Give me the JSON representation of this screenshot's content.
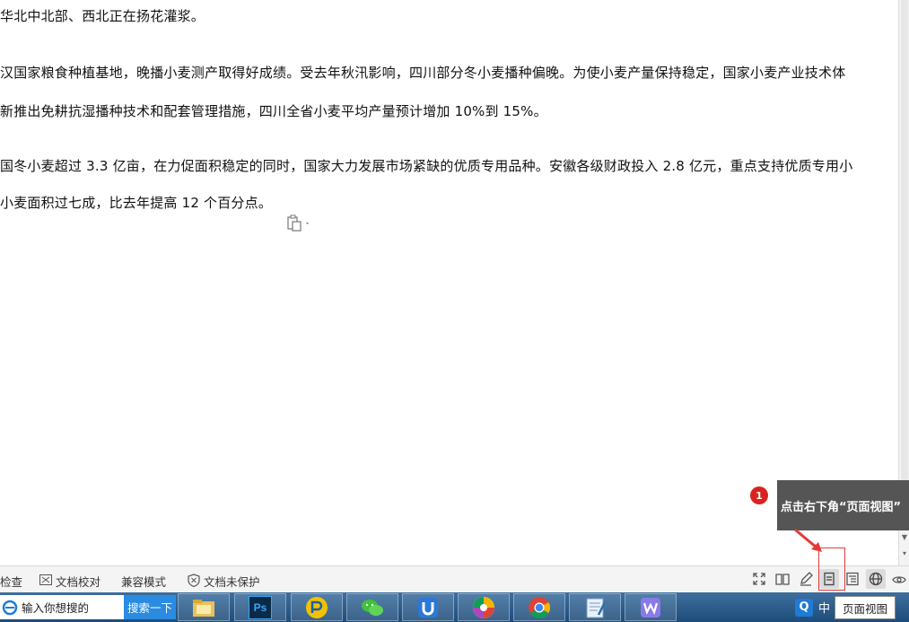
{
  "document": {
    "lines": [
      "华北中北部、西北正在扬花灌浆。",
      "汉国家粮食种植基地，晚播小麦测产取得好成绩。受去年秋汛影响，四川部分冬小麦播种偏晚。为使小麦产量保持稳定，国家小麦产业技术体",
      "新推出免耕抗湿播种技术和配套管理措施，四川全省小麦平均产量预计增加 10%到 15%。",
      "国冬小麦超过 3.3 亿亩，在力促面积稳定的同时，国家大力发展市场紧缺的优质专用品种。安徽各级财政投入 2.8 亿元，重点支持优质专用小",
      "小麦面积过七成，比去年提高 12 个百分点。"
    ]
  },
  "statusbar": {
    "check_label": "检查",
    "proofread_label": "文档校对",
    "compat_label": "兼容模式",
    "protect_label": "文档未保护",
    "view_icons": [
      "fullscreen-icon",
      "reading-view-icon",
      "edit-pen-icon",
      "page-view-icon",
      "outline-view-icon",
      "web-view-icon",
      "eye-protect-icon"
    ]
  },
  "annotation": {
    "badge_number": "1",
    "tooltip_text": "点击右下角“页面视图”",
    "hover_tip": "页面视图"
  },
  "taskbar": {
    "search_placeholder": "输入你想搜的",
    "search_button": "搜索一下",
    "apps": [
      "file-explorer-icon",
      "photoshop-icon",
      "p-app-icon",
      "wechat-icon",
      "u-app-icon",
      "pinwheel-app-icon",
      "chrome-icon",
      "notepad-icon",
      "wps-icon"
    ],
    "ps_label": "Ps",
    "tray_lang": "中"
  },
  "colors": {
    "accent": "#2a8be0",
    "badge": "#d9231f",
    "highlight": "#e23b36",
    "tooltip_bg": "#555555"
  }
}
